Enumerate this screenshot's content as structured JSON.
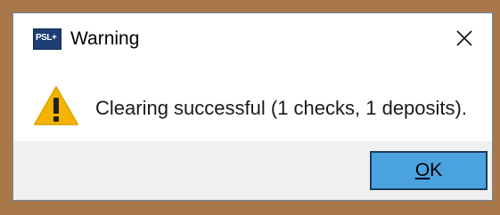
{
  "dialog": {
    "title": "Warning",
    "app_icon_text": "PSL+",
    "message": "Clearing successful (1 checks, 1 deposits).",
    "ok_button": {
      "mnemonic": "O",
      "rest": "K"
    }
  },
  "icons": {
    "app": "app-logo-icon",
    "close": "close-icon",
    "warning": "warning-icon"
  },
  "colors": {
    "background": "#a8784a",
    "footer": "#f0f0f0",
    "ok_button": "#4aa3df",
    "warning": "#f4b400"
  }
}
